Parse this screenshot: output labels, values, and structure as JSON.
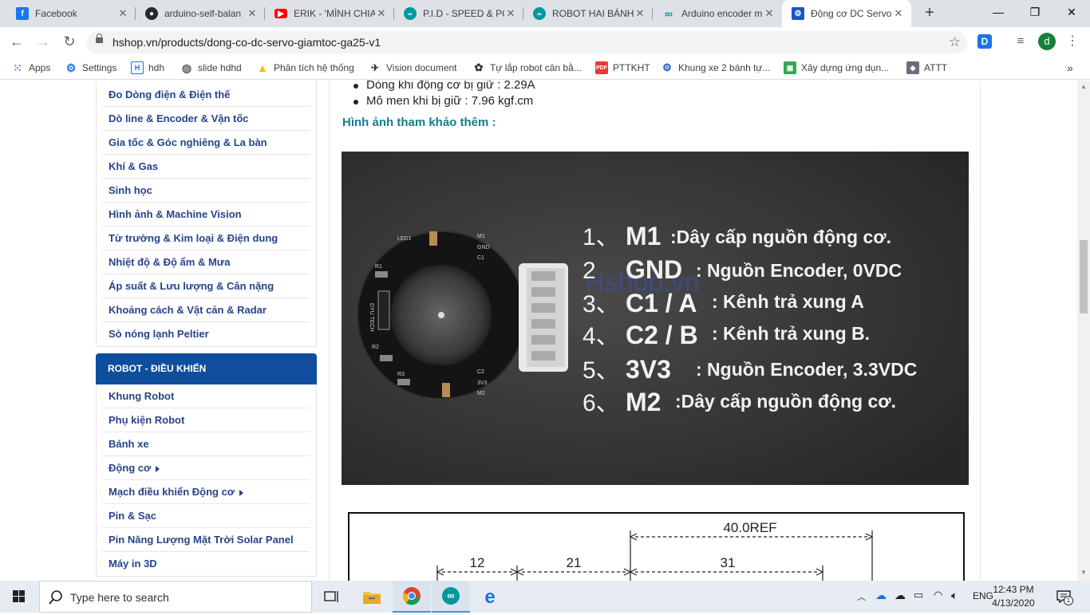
{
  "tabs": [
    {
      "title": "Facebook",
      "icon": "facebook-icon",
      "color": "#1877f2"
    },
    {
      "title": "arduino-self-balan",
      "icon": "github-icon",
      "color": "#24292e"
    },
    {
      "title": "ERIK - 'MÌNH CHIA",
      "icon": "youtube-icon",
      "color": "#ff0000"
    },
    {
      "title": "P.I.D - SPEED & PC",
      "icon": "arduino-icon",
      "color": "#00979d"
    },
    {
      "title": "ROBOT HAI BÁNH",
      "icon": "arduino-icon",
      "color": "#00979d"
    },
    {
      "title": "Arduino encoder m",
      "icon": "arduino-icon",
      "color": "#00979d"
    },
    {
      "title": "Động cơ DC Servo",
      "icon": "hshop-icon",
      "color": "#1a56c4"
    }
  ],
  "toolbar": {
    "url": "hshop.vn/products/dong-co-dc-servo-giamtoc-ga25-v1",
    "ext1": "D",
    "profile": "d"
  },
  "bookmarks": [
    {
      "label": "Apps",
      "icon": "apps-grid-icon"
    },
    {
      "label": "Settings",
      "icon": "gear-icon"
    },
    {
      "label": "hdh",
      "icon": "h-logo-icon"
    },
    {
      "label": "slide hdhd",
      "icon": "globe-icon"
    },
    {
      "label": "Phân tích hệ thống",
      "icon": "google-drive-icon"
    },
    {
      "label": "Vision document",
      "icon": "vision-icon"
    },
    {
      "label": "Tự lắp robot cân bằ...",
      "icon": "robot-icon"
    },
    {
      "label": "PTTKHT",
      "icon": "pdf-icon"
    },
    {
      "label": "Khung xe 2 bánh tự...",
      "icon": "hshop-icon"
    },
    {
      "label": "Xây dựng ứng dụn...",
      "icon": "book-icon"
    },
    {
      "label": "ATTT",
      "icon": "attt-icon"
    }
  ],
  "sidebar": {
    "sensor_items": [
      {
        "label": "Đo Dòng điện & Điện thế"
      },
      {
        "label": "Dò line & Encoder & Vận tốc"
      },
      {
        "label": "Gia tốc & Góc nghiêng & La bàn"
      },
      {
        "label": "Khí & Gas"
      },
      {
        "label": "Sinh học"
      },
      {
        "label": "Hình ảnh & Machine Vision"
      },
      {
        "label": "Từ trường & Kim loại & Điện dung"
      },
      {
        "label": "Nhiệt độ & Độ ẩm & Mưa"
      },
      {
        "label": "Áp suất & Lưu lượng & Cân nặng"
      },
      {
        "label": "Khoảng cách & Vật cản & Radar"
      },
      {
        "label": "Sò nóng lạnh Peltier"
      }
    ],
    "robot_heading": "ROBOT - ĐIỀU KHIỂN",
    "robot_items": [
      {
        "label": "Khung Robot"
      },
      {
        "label": "Phụ kiện Robot"
      },
      {
        "label": "Bánh xe"
      },
      {
        "label": "Động cơ",
        "has_submenu": true
      },
      {
        "label": "Mạch điều khiển Động cơ",
        "has_submenu": true
      },
      {
        "label": "Pin & Sạc"
      },
      {
        "label": "Pin Năng Lượng Mặt Trời Solar Panel"
      },
      {
        "label": "Máy in 3D"
      }
    ]
  },
  "content": {
    "specs": [
      "Dòng khi động cơ bị giữ : 2.29A",
      "Mô men khi bị giữ : 7.96 kgf.cm"
    ],
    "ref_title": "Hình ảnh tham khảo thêm :",
    "photo": {
      "watermark": "Hshop.vn",
      "pins": [
        {
          "num": "1、",
          "code": "M1",
          "desc": ":Dây cấp nguồn động cơ."
        },
        {
          "num": "2",
          "code": "GND",
          "desc": ": Nguồn Encoder, 0VDC"
        },
        {
          "num": "3、",
          "code": "C1 / A",
          "desc": ": Kênh trả xung A"
        },
        {
          "num": "4、",
          "code": "C2 / B",
          "desc": ": Kênh trả xung B."
        },
        {
          "num": "5、",
          "code": "3V3",
          "desc": ": Nguồn Encoder, 3.3VDC"
        },
        {
          "num": "6、",
          "code": "M2",
          "desc": ":Dây cấp nguồn động cơ."
        }
      ],
      "board_labels": {
        "led": "LED1",
        "m1": "M1",
        "gnd": "GND",
        "c1": "C1",
        "r1": "R1",
        "r2": "R2",
        "r3": "R3",
        "c2": "C2",
        "v33": "3V3",
        "m2": "M2",
        "chip": "DYU TECH"
      }
    },
    "drawing": {
      "overall": "40.0REF",
      "dim1": "12",
      "dim2": "21",
      "dim3": "31"
    }
  },
  "taskbar": {
    "search_placeholder": "Type here to search",
    "lang": "ENG",
    "time": "12:43 PM",
    "date": "4/13/2020",
    "notification_count": "1"
  }
}
